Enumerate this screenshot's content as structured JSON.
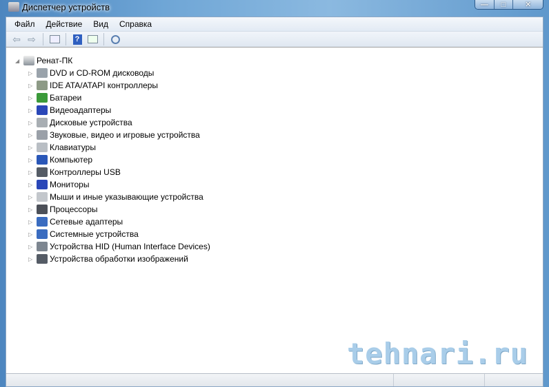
{
  "window": {
    "title": "Диспетчер устройств",
    "minimize": "—",
    "maximize": "□",
    "close": "✕"
  },
  "menu": [
    "Файл",
    "Действие",
    "Вид",
    "Справка"
  ],
  "toolbar": [
    "back-icon",
    "forward-icon",
    "show-hide-console-tree-icon",
    "help-icon",
    "action-pane-icon",
    "scan-hardware-icon"
  ],
  "tree": {
    "root": "Ренат-ПК",
    "items": [
      {
        "label": "DVD и CD-ROM дисководы",
        "color": "#9aa3ab"
      },
      {
        "label": "IDE ATA/ATAPI контроллеры",
        "color": "#8d9a86"
      },
      {
        "label": "Батареи",
        "color": "#3b9a3a"
      },
      {
        "label": "Видеоадаптеры",
        "color": "#2a47b8"
      },
      {
        "label": "Дисковые устройства",
        "color": "#a8aeb3"
      },
      {
        "label": "Звуковые, видео и игровые устройства",
        "color": "#9aa0a8"
      },
      {
        "label": "Клавиатуры",
        "color": "#b9bec4"
      },
      {
        "label": "Компьютер",
        "color": "#2a57b8"
      },
      {
        "label": "Контроллеры USB",
        "color": "#555c66"
      },
      {
        "label": "Мониторы",
        "color": "#2a47b8"
      },
      {
        "label": "Мыши и иные указывающие устройства",
        "color": "#c3c7cc"
      },
      {
        "label": "Процессоры",
        "color": "#4c5058"
      },
      {
        "label": "Сетевые адаптеры",
        "color": "#3a6cc0"
      },
      {
        "label": "Системные устройства",
        "color": "#3a6cc0"
      },
      {
        "label": "Устройства HID (Human Interface Devices)",
        "color": "#7d8690"
      },
      {
        "label": "Устройства обработки изображений",
        "color": "#555c66"
      }
    ]
  },
  "watermark": "tehnari.ru"
}
